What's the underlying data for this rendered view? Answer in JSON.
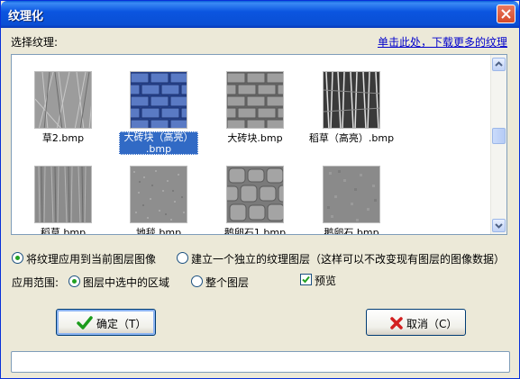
{
  "window": {
    "title": "纹理化"
  },
  "header": {
    "select_label": "选择纹理:",
    "download_link": "单击此处，下载更多的纹理"
  },
  "textures": [
    {
      "caption": "草2.bmp",
      "selected": false
    },
    {
      "caption": "大砖块（高亮）.bmp",
      "caption_line1": "大砖块（高亮）",
      "caption_line2": ".bmp",
      "selected": true
    },
    {
      "caption": "大砖块.bmp",
      "selected": false
    },
    {
      "caption": "稻草（高亮）.bmp",
      "selected": false
    },
    {
      "caption": "稻草.bmp",
      "selected": false
    },
    {
      "caption": "地毯.bmp",
      "selected": false
    },
    {
      "caption": "鹅卵石1.bmp",
      "selected": false
    },
    {
      "caption": "鹅卵石.bmp",
      "selected": false
    }
  ],
  "options": {
    "apply_current": "将纹理应用到当前图层图像",
    "apply_new_layer": "建立一个独立的纹理图层（这样可以不改变现有图层的图像数据）",
    "apply_current_selected": true,
    "range_label": "应用范围:",
    "range_selection": "图层中选中的区域",
    "range_whole": "整个图层",
    "range_selection_selected": true,
    "preview_label": "预览",
    "preview_checked": true
  },
  "buttons": {
    "ok": "确定（T）",
    "cancel": "取消（C）"
  },
  "status": {
    "text": ""
  },
  "colors": {
    "title_bar": "#0b55e0",
    "selection": "#316ac5",
    "link": "#0000cc",
    "dialog_bg": "#ece9d8"
  }
}
